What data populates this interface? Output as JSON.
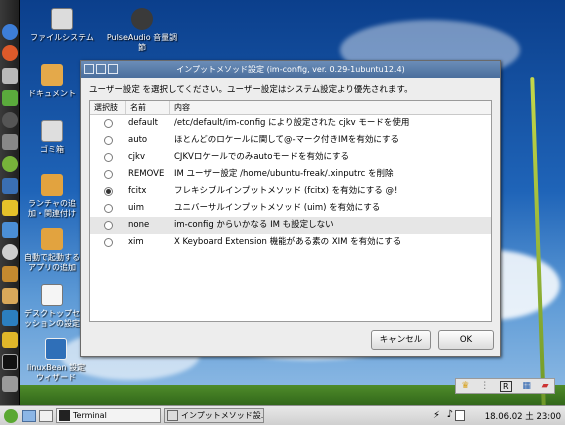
{
  "desktop": {
    "icons": [
      {
        "label": "ファイルシステム"
      },
      {
        "label": "PulseAudio 音量調節"
      },
      {
        "label": "ドキュメント"
      },
      {
        "label": "ゴミ箱"
      },
      {
        "label": "ランチャの追加・関連付け"
      },
      {
        "label": "自動で起動するアプリの追加"
      },
      {
        "label": "デスクトップセッションの設定"
      },
      {
        "label": "linuxBean 設定ウィザード"
      }
    ]
  },
  "dialog": {
    "title": "インプットメソッド設定 (im-config, ver. 0.29-1ubuntu12.4)",
    "prompt": "ユーザー設定 を選択してください。ユーザー設定はシステム設定より優先されます。",
    "columns": [
      "選択肢",
      "名前",
      "内容"
    ],
    "rows": [
      {
        "name": "default",
        "desc": "/etc/default/im-config により設定された cjkv モードを使用",
        "selected": false
      },
      {
        "name": "auto",
        "desc": "ほとんどのロケールに関して@-マーク付きIMを有効にする",
        "selected": false
      },
      {
        "name": "cjkv",
        "desc": "CJKVロケールでのみautoモードを有効にする",
        "selected": false
      },
      {
        "name": "REMOVE",
        "desc": "IM ユーザー設定 /home/ubuntu-freak/.xinputrc を削除",
        "selected": false
      },
      {
        "name": "fcitx",
        "desc": "フレキシブルインプットメソッド (fcitx) を有効にする @!",
        "selected": true
      },
      {
        "name": "uim",
        "desc": "ユニバーサルインプットメソッド (uim) を有効にする",
        "selected": false
      },
      {
        "name": "none",
        "desc": "im-config からいかなる IM も設定しない",
        "selected": false
      },
      {
        "name": "xim",
        "desc": "X Keyboard Extension 機能がある素の XIM を有効にする",
        "selected": false
      }
    ],
    "cancel_label": "キャンセル",
    "ok_label": "OK"
  },
  "taskbar": {
    "tasks": [
      "Terminal",
      "インプットメソッド設..."
    ],
    "clock": "18.06.02 土 23:00"
  },
  "tray": {
    "r_label": "R"
  }
}
